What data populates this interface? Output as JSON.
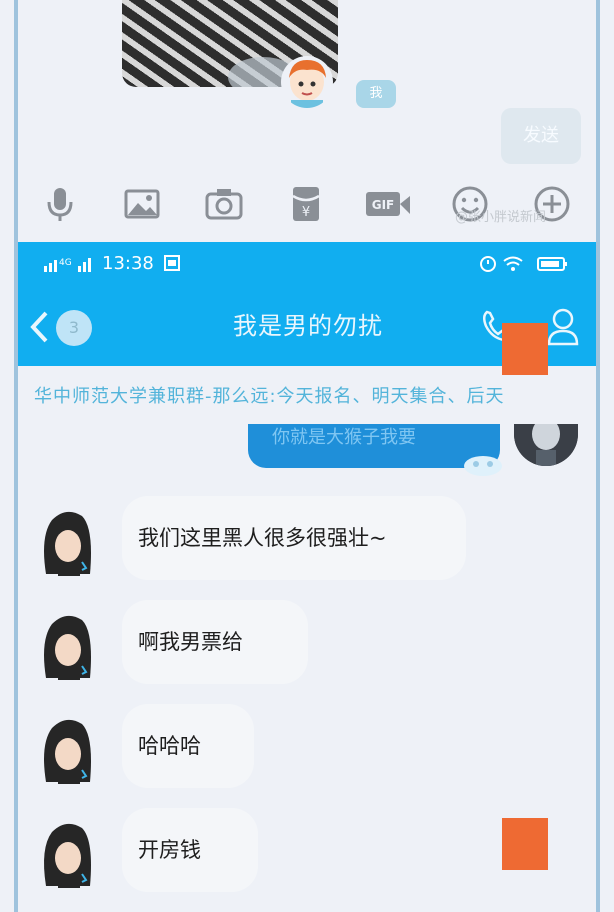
{
  "prev_screen": {
    "me_label": "我",
    "send_label": "发送",
    "toolbar_icons": [
      "mic-icon",
      "image-icon",
      "camera-icon",
      "red-packet-icon",
      "gif-icon",
      "emoji-icon",
      "plus-icon"
    ],
    "watermark": "@张小胖说新闻"
  },
  "status_bar": {
    "network": "4G",
    "time": "13:38"
  },
  "header": {
    "unread_count": "3",
    "title": "我是男的勿扰"
  },
  "group_notice": "华中师范大学兼职群-那么远:今天报名、明天集合、后天",
  "sent_message": {
    "text": "你就是大猴子我要"
  },
  "messages": [
    {
      "text": "我们这里黑人很多很强壮~"
    },
    {
      "text": "啊我男票给"
    },
    {
      "text": "哈哈哈"
    },
    {
      "text": "开房钱"
    }
  ],
  "colors": {
    "header_blue": "#11aef0",
    "bubble_bg": "#f4f6f9",
    "sent_bubble": "#1f8fd9",
    "notice_text": "#53b4da",
    "censor_orange": "#ee6a33"
  }
}
